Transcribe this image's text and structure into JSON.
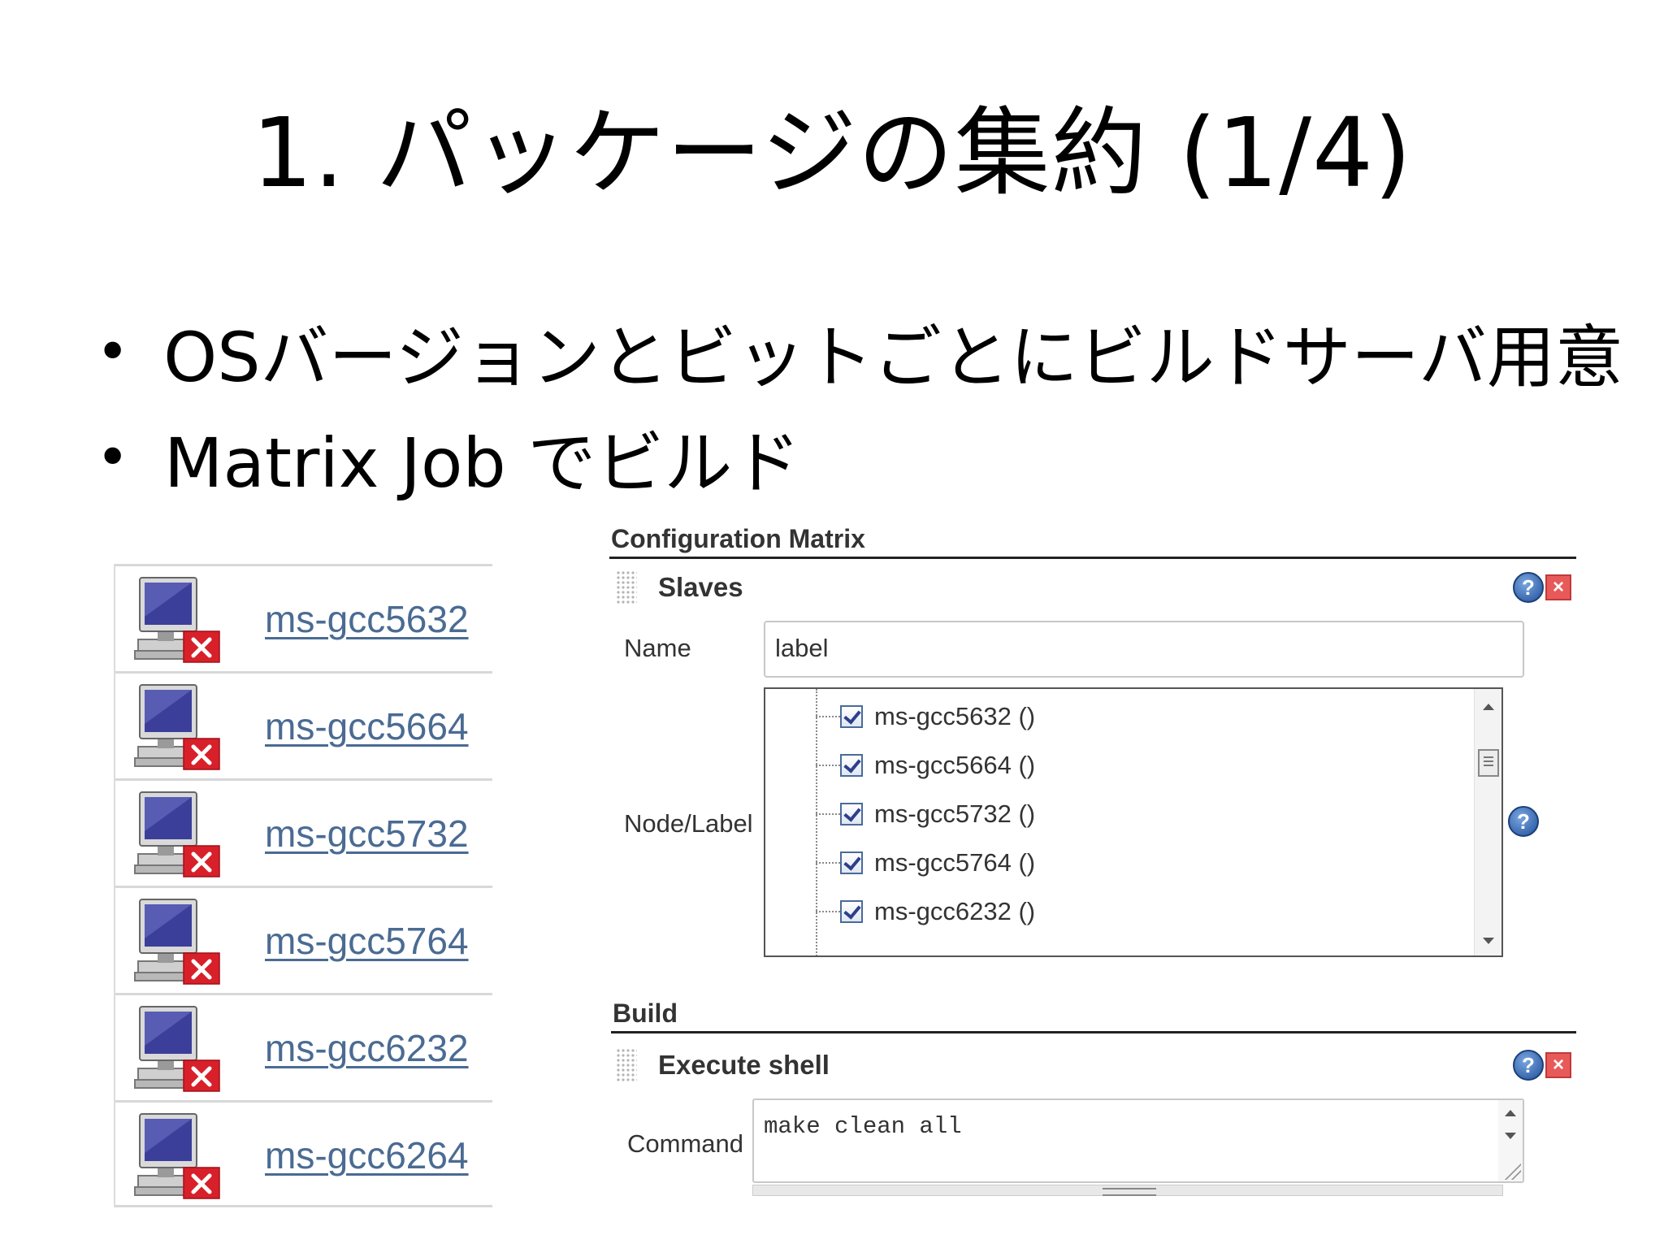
{
  "slide": {
    "title": "1. パッケージの集約 (1/4)",
    "bullets": [
      "OSバージョンとビットごとにビルドサーバ用意",
      "Matrix Job でビルド"
    ],
    "bullet_char": "•"
  },
  "node_list": {
    "icon": "offline-computer-icon",
    "nodes": [
      "ms-gcc5632",
      "ms-gcc5664",
      "ms-gcc5732",
      "ms-gcc5764",
      "ms-gcc6232",
      "ms-gcc6264"
    ]
  },
  "config": {
    "section_title": "Configuration Matrix",
    "axis_title": "Slaves",
    "name_label": "Name",
    "name_value": "label",
    "node_label": "Node/Label",
    "tree_items": [
      "ms-gcc5632 ()",
      "ms-gcc5664 ()",
      "ms-gcc5732 ()",
      "ms-gcc5764 ()",
      "ms-gcc6232 ()"
    ],
    "help_glyph": "?",
    "delete_glyph": "×"
  },
  "build": {
    "section_title": "Build",
    "step_title": "Execute shell",
    "command_label": "Command",
    "command_value": "make clean all"
  },
  "colors": {
    "link": "#4a6b93",
    "offline_badge": "#d8202a"
  }
}
